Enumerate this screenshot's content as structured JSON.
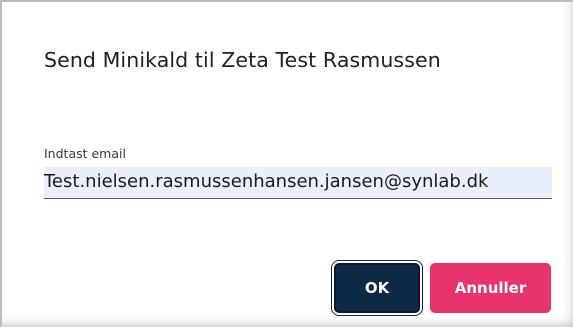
{
  "dialog": {
    "title": "Send Minikald til Zeta Test Rasmussen"
  },
  "email_field": {
    "label": "Indtast email",
    "value": "Test.nielsen.rasmussenhansen.jansen@synlab.dk"
  },
  "buttons": {
    "ok_label": "OK",
    "cancel_label": "Annuller"
  },
  "colors": {
    "ok_bg": "#0e2a47",
    "cancel_bg": "#e8336b",
    "input_bg": "#e9f0fb"
  }
}
